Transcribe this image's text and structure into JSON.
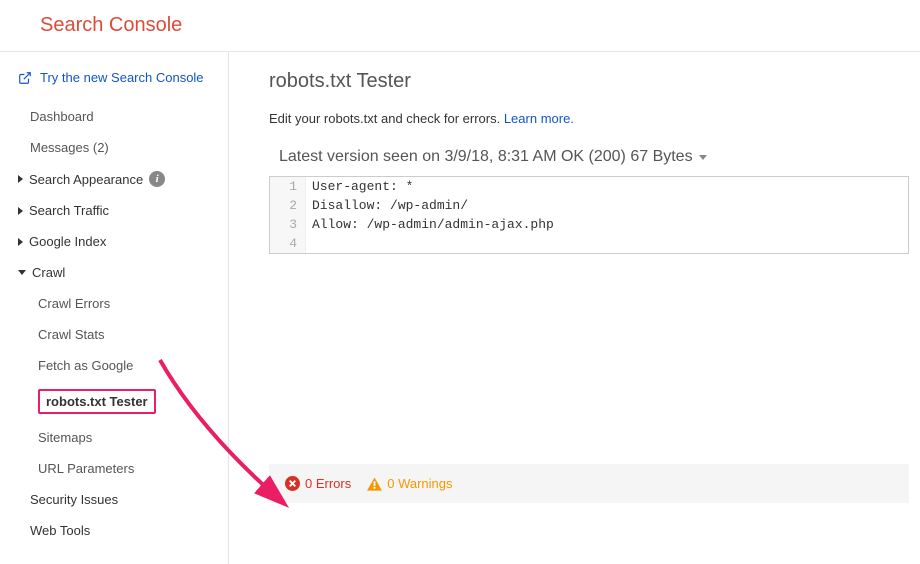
{
  "header": {
    "title": "Search Console"
  },
  "sidebar": {
    "newConsole": "Try the new Search Console",
    "dashboard": "Dashboard",
    "messages": "Messages (2)",
    "searchAppearance": "Search Appearance",
    "searchTraffic": "Search Traffic",
    "googleIndex": "Google Index",
    "crawl": "Crawl",
    "crawlErrors": "Crawl Errors",
    "crawlStats": "Crawl Stats",
    "fetchAsGoogle": "Fetch as Google",
    "robotsTester": "robots.txt Tester",
    "sitemaps": "Sitemaps",
    "urlParameters": "URL Parameters",
    "securityIssues": "Security Issues",
    "webTools": "Web Tools"
  },
  "main": {
    "title": "robots.txt Tester",
    "subtitle": "Edit your robots.txt and check for errors. ",
    "learnMore": "Learn more.",
    "versionLine": "Latest version seen on 3/9/18, 8:31 AM OK (200) 67 Bytes",
    "code": {
      "l1": "User-agent: *",
      "l2": "Disallow: /wp-admin/",
      "l3": "Allow: /wp-admin/admin-ajax.php",
      "l4": ""
    },
    "status": {
      "errors": "0 Errors",
      "warnings": "0 Warnings"
    }
  }
}
